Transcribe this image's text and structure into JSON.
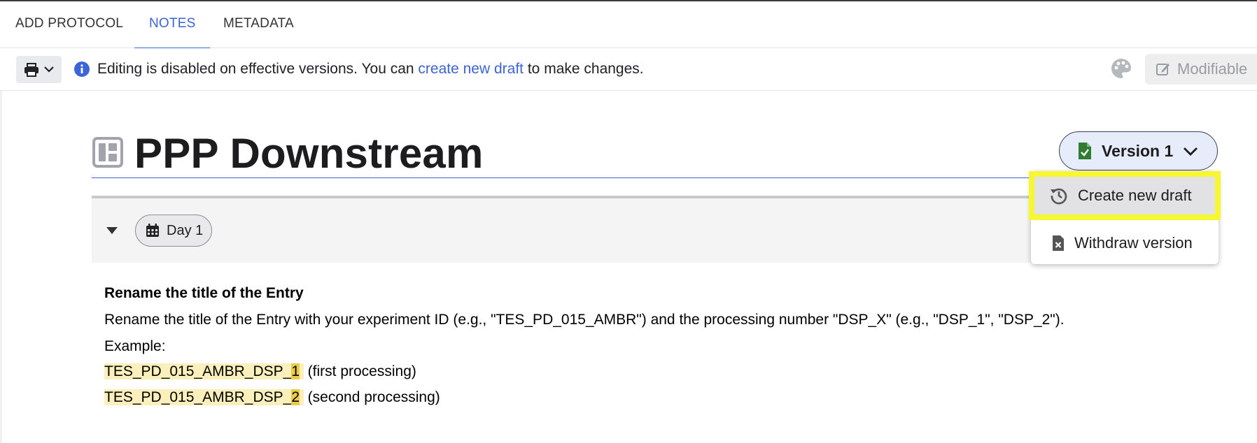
{
  "tabs": [
    {
      "label": "ADD PROTOCOL",
      "active": false
    },
    {
      "label": "NOTES",
      "active": true
    },
    {
      "label": "METADATA",
      "active": false
    }
  ],
  "infobar": {
    "print_icon": "printer-icon",
    "message_before": "Editing is disabled on effective versions. You can ",
    "message_link": "create new draft",
    "message_after": " to make changes.",
    "modifiable_label": "Modifiable"
  },
  "entry": {
    "title": "PPP Downstream",
    "version_label": "Version 1",
    "day_label": "Day 1"
  },
  "version_menu": {
    "items": [
      {
        "label": "Create new draft",
        "icon": "history-icon",
        "highlighted": true
      },
      {
        "label": "Withdraw version",
        "icon": "file-x-icon",
        "highlighted": false
      }
    ]
  },
  "content": {
    "heading": "Rename the title of the Entry",
    "paragraph": "Rename the title of the Entry with your experiment ID (e.g., \"TES_PD_015_AMBR\") and the processing number  \"DSP_X\" (e.g., \"DSP_1\", \"DSP_2\").",
    "example_label": "Example:",
    "examples": [
      {
        "prefix": "TES_PD_015_AMBR_DSP_",
        "number": "1",
        "suffix": " (first processing)"
      },
      {
        "prefix": "TES_PD_015_AMBR_DSP_",
        "number": "2",
        "suffix": " (second processing)"
      }
    ]
  },
  "colors": {
    "accent": "#3d63d8",
    "highlight_light": "#fbf0bb",
    "highlight_strong": "#eccb48",
    "focus_outline": "#f7f731",
    "version_green": "#2e7d32"
  }
}
